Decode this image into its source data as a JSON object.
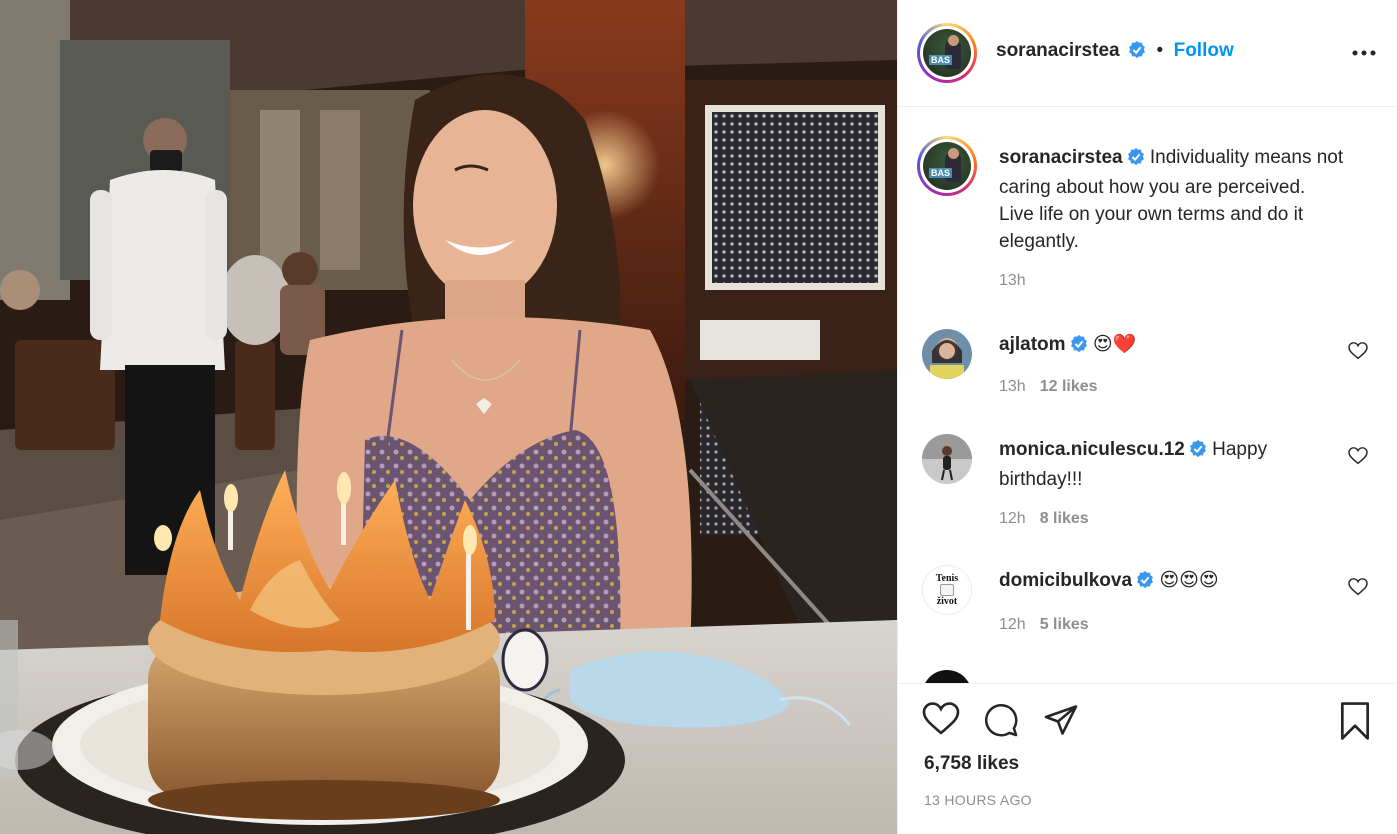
{
  "post": {
    "author": "soranacirstea",
    "follow_label": "Follow",
    "separator": "•",
    "caption": "Individuality means not caring about how you are perceived. Live life on your own terms and do it elegantly.",
    "caption_time": "13h",
    "likes": "6,758 likes",
    "time_ago": "13 HOURS AGO"
  },
  "comments": [
    {
      "user": "ajlatom",
      "text": "😍❤️",
      "time": "13h",
      "likes": "12 likes"
    },
    {
      "user": "monica.niculescu.12",
      "text": "Happy birthday!!!",
      "time": "12h",
      "likes": "8 likes"
    },
    {
      "user": "domicibulkova",
      "text": "😍😍😍",
      "time": "12h",
      "likes": "5 likes"
    }
  ],
  "avatar_labels": {
    "author_badge": "BAS",
    "domi_line1": "Tenis",
    "domi_line2": "život"
  },
  "icons": {
    "verified": "verified-badge-icon",
    "more": "more-options-icon",
    "comment_like": "heart-outline-icon",
    "like": "heart-icon",
    "comment": "comment-bubble-icon",
    "share": "paper-plane-icon",
    "save": "bookmark-icon"
  },
  "colors": {
    "accent": "#0095f6",
    "verified": "#3897f0",
    "secondary_text": "#8e8e8e",
    "divider": "#efefef"
  }
}
